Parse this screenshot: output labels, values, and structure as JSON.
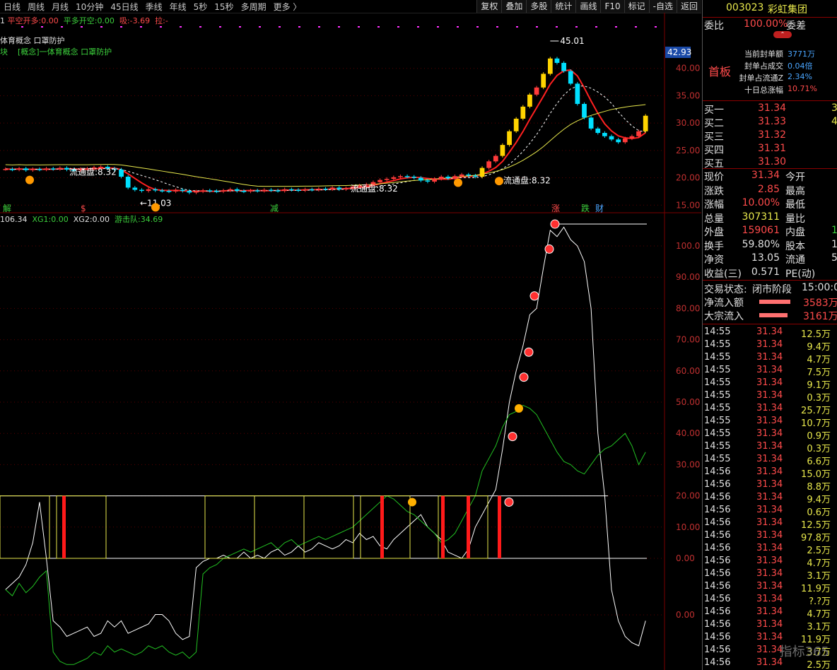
{
  "periods": [
    "日线",
    "周线",
    "月线",
    "10分钟",
    "45日线",
    "季线",
    "年线",
    "5秒",
    "15秒",
    "多周期",
    "更多 〉"
  ],
  "tools": [
    "复权",
    "叠加",
    "多股",
    "统计",
    "画线",
    "F10",
    "标记",
    "-自选",
    "返回"
  ],
  "indicator": {
    "prefix": "1",
    "a_label": "平空开多:",
    "a_val": "0.00",
    "b_label": "平多开空:",
    "b_val": "0.00",
    "c_label": "吸:",
    "c_val": "-3.69",
    "d_label": "拉:",
    "d_val": "-"
  },
  "concepts": {
    "line1": "体育概念 口罩防护",
    "line2_a": "块",
    "line2_b": "[概念]一体育概念 口罩防护"
  },
  "sub_indicator": {
    "a": "106.34",
    "xg1_label": "XG1:",
    "xg1": "0.00",
    "xg2_label": "XG2:",
    "xg2": "0.00",
    "yjd_label": "游击队:",
    "yjd": "34.69"
  },
  "price_axis": [
    "40.00",
    "35.00",
    "30.00",
    "25.00",
    "20.00",
    "15.00"
  ],
  "price_tag": "42.93",
  "sub_axis": [
    "100.0",
    "90.00",
    "80.00",
    "70.00",
    "60.00",
    "50.00",
    "40.00",
    "30.00",
    "20.00",
    "10.00",
    "0.00",
    "0.00"
  ],
  "annotations": {
    "high": "45.01",
    "low": "←11.03",
    "flow1": "流通盘:8.32",
    "flow2": "流通盘:8.32",
    "flow3": "流通盘:8.32",
    "ev_jie": "解",
    "ev_s": "$",
    "ev_jian": "减",
    "ev_zhang": "涨",
    "ev_die": "跌",
    "ev_cai": "财"
  },
  "chart_data": {
    "type": "candlestick",
    "price_range": [
      14,
      45
    ],
    "high_label": 45.01,
    "low_label": 11.03,
    "closes": [
      21.6,
      21.5,
      21.7,
      21.4,
      21.6,
      21.5,
      21.7,
      21.6,
      21.8,
      21.5,
      21.4,
      21.6,
      21.7,
      21.9,
      22.0,
      21.7,
      21.5,
      20.2,
      18.2,
      17.8,
      17.6,
      17.9,
      17.7,
      17.6,
      17.5,
      17.8,
      17.6,
      17.3,
      17.5,
      17.7,
      17.6,
      17.5,
      17.7,
      17.9,
      17.6,
      17.5,
      17.7,
      17.6,
      17.8,
      17.7,
      17.6,
      17.9,
      17.8,
      17.7,
      17.9,
      17.8,
      18.0,
      17.9,
      18.2,
      17.9,
      18.1,
      18.4,
      18.6,
      18.8,
      19.2,
      19.6,
      19.8,
      20.1,
      20.3,
      20.2,
      20.0,
      19.5,
      19.3,
      19.8,
      20.2,
      19.9,
      20.3,
      20.6,
      20.4,
      20.2,
      21.8,
      23.0,
      24.0,
      26.0,
      28.5,
      30.8,
      33.0,
      35.2,
      36.5,
      39.0,
      41.8,
      41.0,
      39.5,
      37.2,
      33.5,
      31.0,
      29.0,
      28.2,
      27.6,
      27.0,
      26.5,
      27.2,
      27.6,
      28.5,
      31.34
    ]
  },
  "quote": {
    "code": "003023",
    "name": "彩虹集团",
    "wb_label": "委比",
    "wb_val": "100.00%",
    "wc_label": "委差",
    "board": "首板",
    "stats": [
      {
        "label": "当前封单额",
        "val": "3771万"
      },
      {
        "label": "封单占成交",
        "val": "0.04倍"
      },
      {
        "label": "封单占流通Z",
        "val": "2.34%"
      },
      {
        "label": "十日总涨幅",
        "val": "10.71%"
      }
    ],
    "bids": [
      {
        "label": "买一",
        "price": "31.34",
        "vol": "3"
      },
      {
        "label": "买二",
        "price": "31.33",
        "vol": "4"
      },
      {
        "label": "买三",
        "price": "31.32",
        "vol": ""
      },
      {
        "label": "买四",
        "price": "31.31",
        "vol": ""
      },
      {
        "label": "买五",
        "price": "31.30",
        "vol": ""
      }
    ],
    "info": [
      {
        "l1": "现价",
        "v1": "31.34",
        "l2": "今开"
      },
      {
        "l1": "涨跌",
        "v1": "2.85",
        "l2": "最高"
      },
      {
        "l1": "涨幅",
        "v1": "10.00%",
        "l2": "最低"
      },
      {
        "l1": "总量",
        "v1": "307311",
        "l2": "量比"
      },
      {
        "l1": "外盘",
        "v1": "159061",
        "l2": "内盘",
        "v2": "1"
      },
      {
        "l1": "换手",
        "v1": "59.80%",
        "l2": "股本",
        "v2": "1"
      },
      {
        "l1": "净资",
        "v1": "13.05",
        "l2": "流通",
        "v2": "5"
      },
      {
        "l1": "收益(三)",
        "v1": "0.571",
        "l2": "PE(动)"
      }
    ],
    "status_label": "交易状态:",
    "status_val": "闭市阶段",
    "status_time": "15:00:0",
    "netflow_label": "净流入额",
    "netflow_val": "3583万",
    "bigflow_label": "大宗流入",
    "bigflow_val": "3161万"
  },
  "trades": [
    {
      "t": "14:55",
      "p": "31.34",
      "v": "12.5万"
    },
    {
      "t": "14:55",
      "p": "31.34",
      "v": "9.4万"
    },
    {
      "t": "14:55",
      "p": "31.34",
      "v": "4.7万"
    },
    {
      "t": "14:55",
      "p": "31.34",
      "v": "7.5万"
    },
    {
      "t": "14:55",
      "p": "31.34",
      "v": "9.1万"
    },
    {
      "t": "14:55",
      "p": "31.34",
      "v": "0.3万"
    },
    {
      "t": "14:55",
      "p": "31.34",
      "v": "25.7万"
    },
    {
      "t": "14:55",
      "p": "31.34",
      "v": "10.7万"
    },
    {
      "t": "14:55",
      "p": "31.34",
      "v": "0.9万"
    },
    {
      "t": "14:55",
      "p": "31.34",
      "v": "0.3万"
    },
    {
      "t": "14:55",
      "p": "31.34",
      "v": "6.6万"
    },
    {
      "t": "14:56",
      "p": "31.34",
      "v": "15.0万"
    },
    {
      "t": "14:56",
      "p": "31.34",
      "v": "8.8万"
    },
    {
      "t": "14:56",
      "p": "31.34",
      "v": "9.4万"
    },
    {
      "t": "14:56",
      "p": "31.34",
      "v": "0.6万"
    },
    {
      "t": "14:56",
      "p": "31.34",
      "v": "12.5万"
    },
    {
      "t": "14:56",
      "p": "31.34",
      "v": "97.8万"
    },
    {
      "t": "14:56",
      "p": "31.34",
      "v": "2.5万"
    },
    {
      "t": "14:56",
      "p": "31.34",
      "v": "4.7万"
    },
    {
      "t": "14:56",
      "p": "31.34",
      "v": "3.1万"
    },
    {
      "t": "14:56",
      "p": "31.34",
      "v": "11.9万"
    },
    {
      "t": "14:56",
      "p": "31.34",
      "v": "?.?万"
    },
    {
      "t": "14:56",
      "p": "31.34",
      "v": "4.7万"
    },
    {
      "t": "14:56",
      "p": "31.34",
      "v": "3.1万"
    },
    {
      "t": "14:56",
      "p": "31.34",
      "v": "11.9万"
    },
    {
      "t": "14:56",
      "p": "31.34",
      "v": "3.7万"
    },
    {
      "t": "14:56",
      "p": "31.34",
      "v": "2.5万"
    }
  ],
  "watermark": "指标365",
  "colors": {
    "up": "#ff3b3b",
    "down": "#00e0ff",
    "limit": "#ffd400",
    "ma_red": "#ff2020",
    "ma_yel": "#e8e84c",
    "white": "#ffffff",
    "green": "#22c022"
  }
}
